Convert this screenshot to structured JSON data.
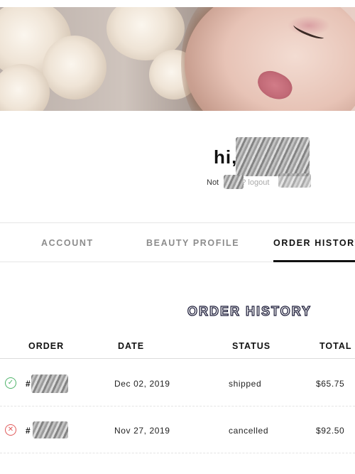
{
  "greeting": {
    "prefix": "hi,",
    "not_prefix": "Not",
    "not_suffix": "? logout"
  },
  "tabs": [
    {
      "label": "ACCOUNT",
      "active": false
    },
    {
      "label": "BEAUTY PROFILE",
      "active": false
    },
    {
      "label": "ORDER HISTORY",
      "active": true
    }
  ],
  "order_history": {
    "title": "ORDER HISTORY",
    "columns": [
      "ORDER",
      "DATE",
      "STATUS",
      "TOTAL"
    ],
    "rows": [
      {
        "icon": "check-circle-icon",
        "order_prefix": "#",
        "date": "Dec 02, 2019",
        "status": "shipped",
        "total": "$65.75"
      },
      {
        "icon": "x-circle-icon",
        "order_prefix": "#",
        "date": "Nov 27, 2019",
        "status": "cancelled",
        "total": "$92.50"
      }
    ]
  },
  "colors": {
    "shipped_icon": "#4fb36a",
    "cancelled_icon": "#e05a5a",
    "title_stroke": "#1e1e3a"
  }
}
